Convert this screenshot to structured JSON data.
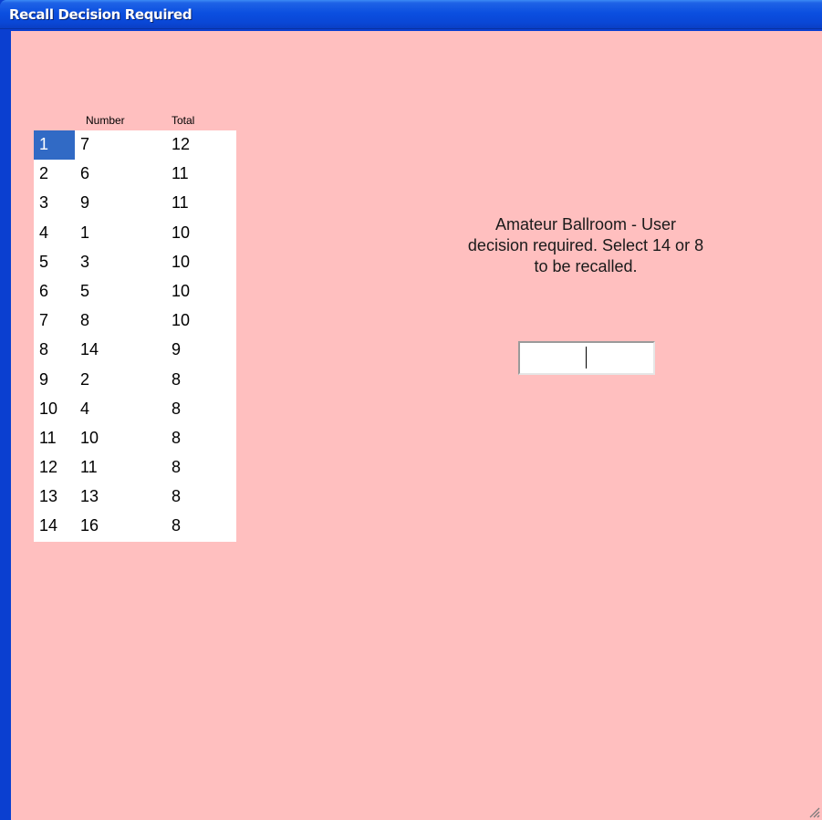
{
  "window": {
    "title": "Recall Decision Required"
  },
  "grid": {
    "headers": {
      "number": "Number",
      "total": "Total"
    },
    "selected_row": 0,
    "rows": [
      {
        "index": "1",
        "number": "7",
        "total": "12"
      },
      {
        "index": "2",
        "number": "6",
        "total": "11"
      },
      {
        "index": "3",
        "number": "9",
        "total": "11"
      },
      {
        "index": "4",
        "number": "1",
        "total": "10"
      },
      {
        "index": "5",
        "number": "3",
        "total": "10"
      },
      {
        "index": "6",
        "number": "5",
        "total": "10"
      },
      {
        "index": "7",
        "number": "8",
        "total": "10"
      },
      {
        "index": "8",
        "number": "14",
        "total": "9"
      },
      {
        "index": "9",
        "number": "2",
        "total": "8"
      },
      {
        "index": "10",
        "number": "4",
        "total": "8"
      },
      {
        "index": "11",
        "number": "10",
        "total": "8"
      },
      {
        "index": "12",
        "number": "11",
        "total": "8"
      },
      {
        "index": "13",
        "number": "13",
        "total": "8"
      },
      {
        "index": "14",
        "number": "16",
        "total": "8"
      }
    ]
  },
  "message": {
    "lines": [
      "Amateur Ballroom - User",
      "decision required. Select 14 or 8",
      "to be recalled."
    ]
  },
  "choice_input": {
    "value": ""
  },
  "colors": {
    "client_background": "#ffbfbf",
    "selection": "#316ac5",
    "titlebar": "#0b4fe0"
  }
}
